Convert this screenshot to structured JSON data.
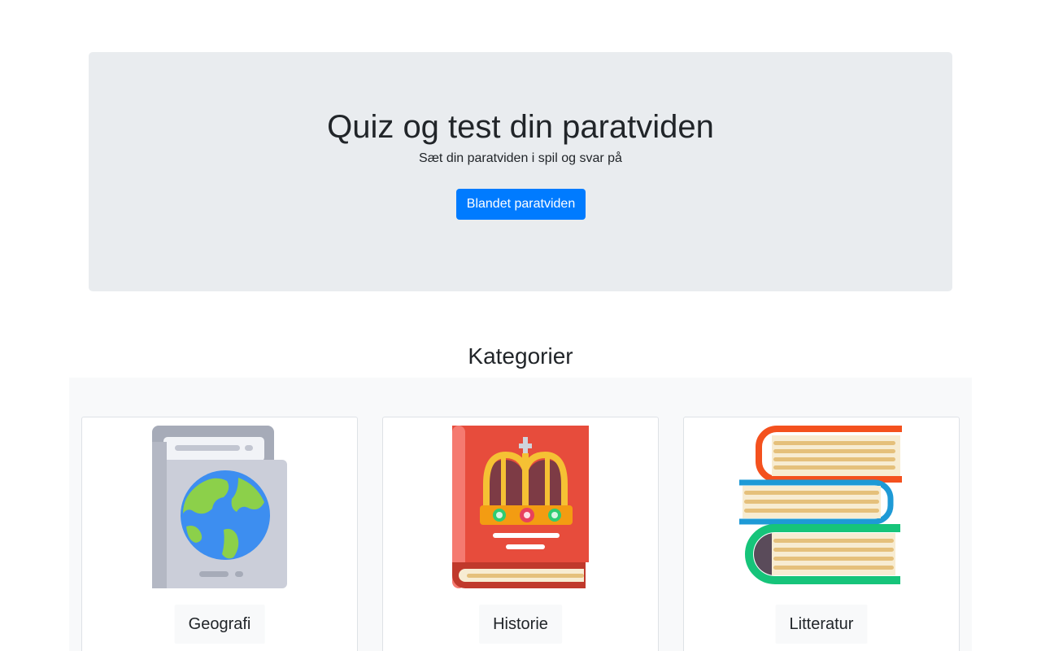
{
  "hero": {
    "title": "Quiz og test din paratviden",
    "subtitle": "Sæt din paratviden i spil og svar på",
    "button_label": "Blandet paratviden",
    "button_color": "#007bff",
    "background": "#e9ecef"
  },
  "categories": {
    "heading": "Kategorier",
    "items": [
      {
        "label": "Geografi",
        "icon": "globe-book-icon"
      },
      {
        "label": "Historie",
        "icon": "crown-book-icon"
      },
      {
        "label": "Litteratur",
        "icon": "book-stack-icon"
      }
    ]
  }
}
